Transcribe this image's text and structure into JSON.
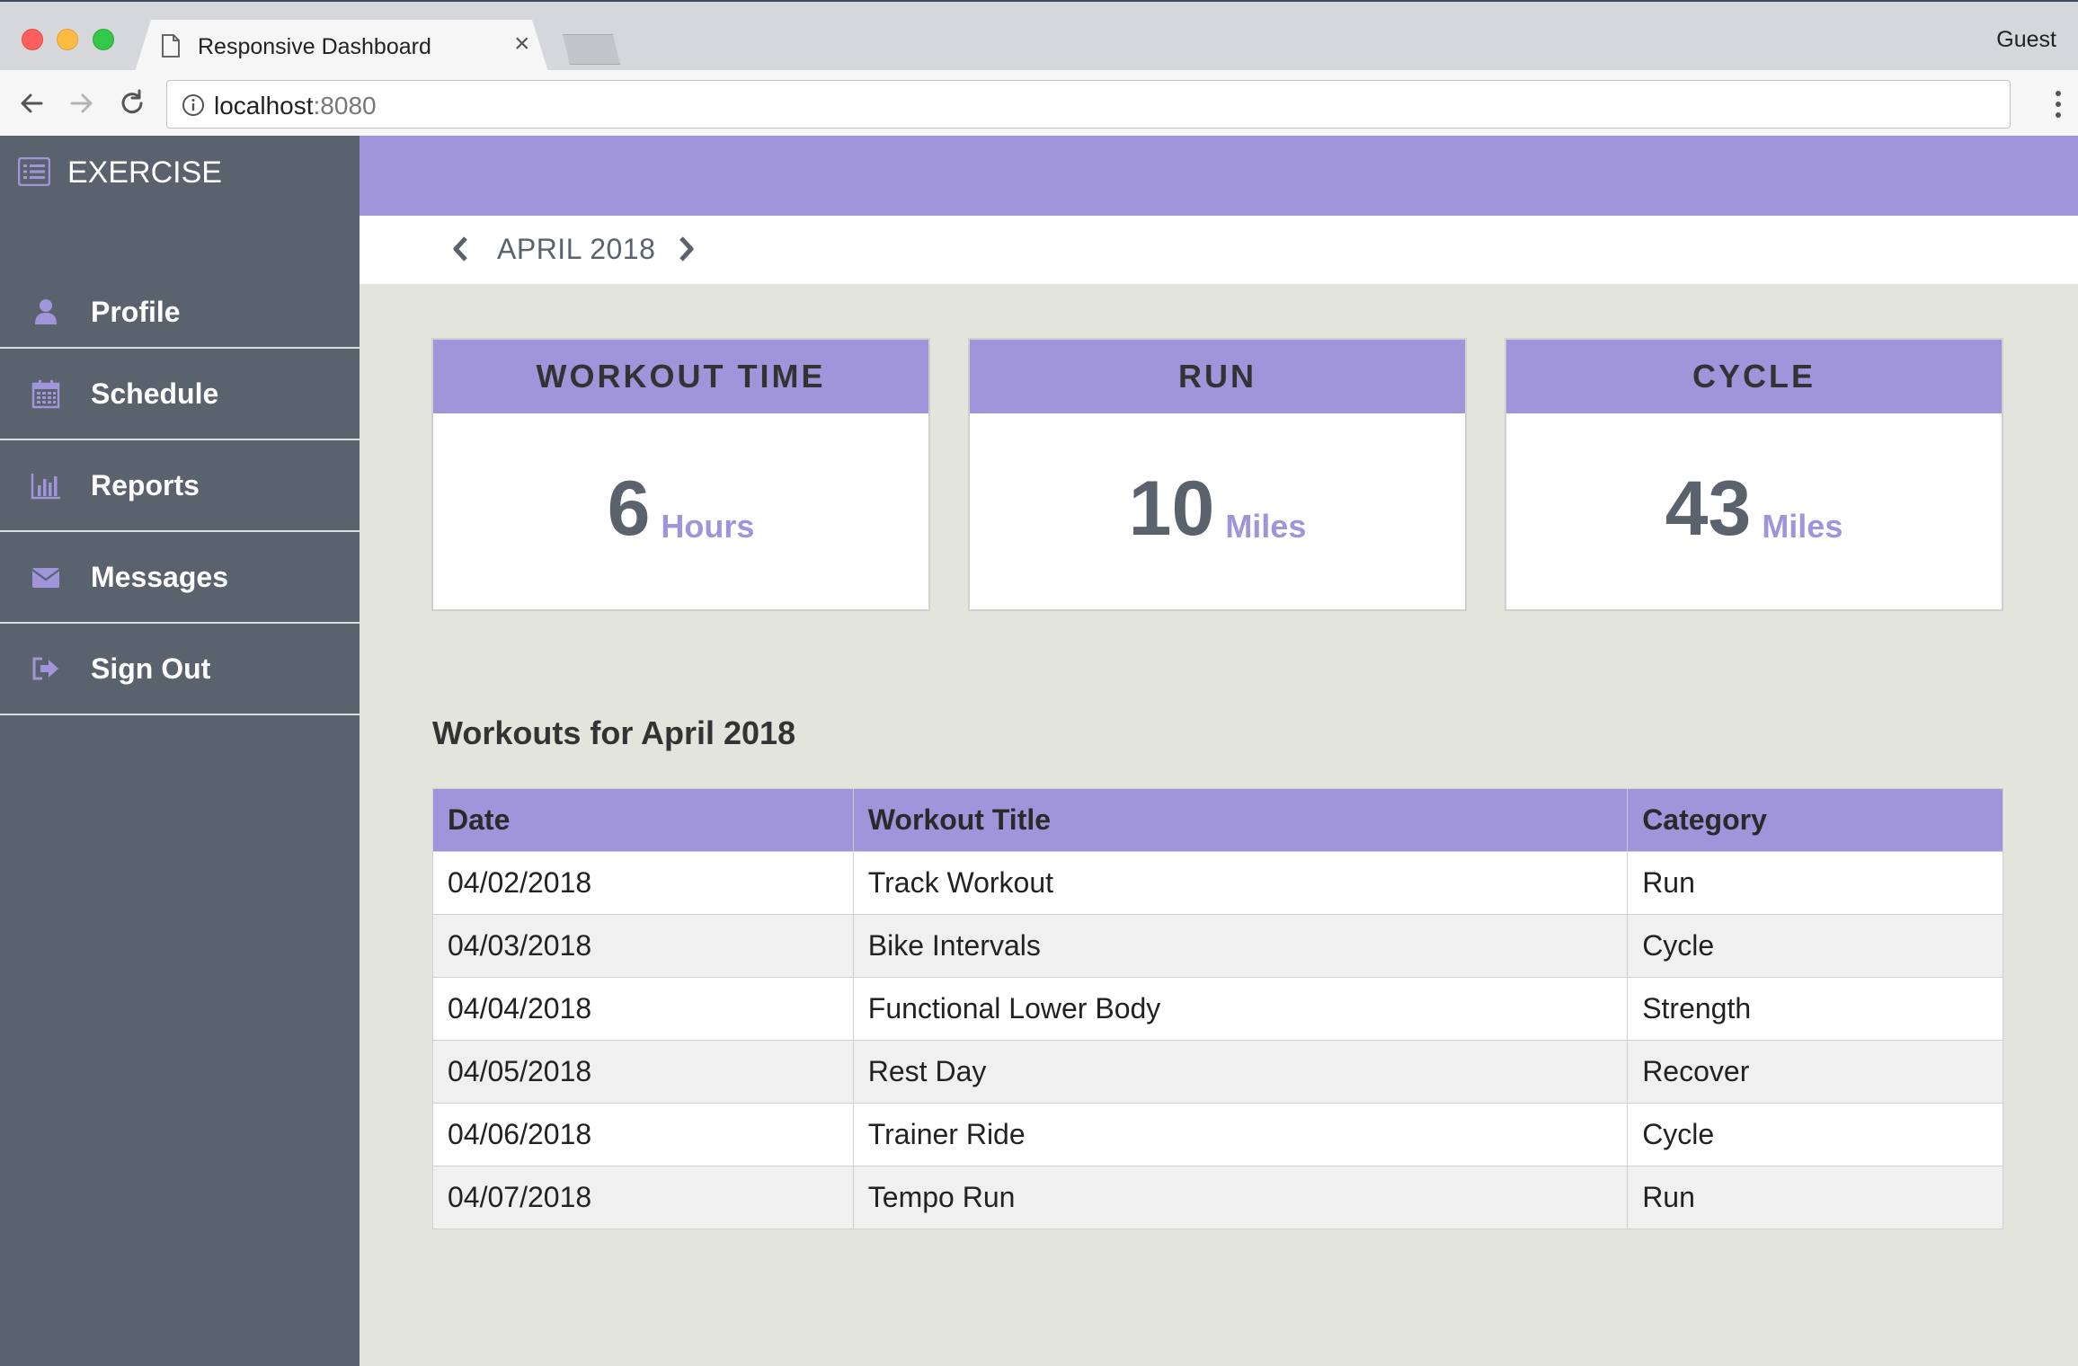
{
  "browser": {
    "tab_title": "Responsive Dashboard",
    "close_glyph": "×",
    "profile": "Guest",
    "url_host": "localhost",
    "url_port": ":8080"
  },
  "sidebar": {
    "brand": "EXERCISE",
    "items": [
      {
        "label": "Profile",
        "icon": "user-icon"
      },
      {
        "label": "Schedule",
        "icon": "calendar-icon"
      },
      {
        "label": "Reports",
        "icon": "bar-chart-icon"
      },
      {
        "label": "Messages",
        "icon": "envelope-icon"
      },
      {
        "label": "Sign Out",
        "icon": "sign-out-icon"
      }
    ]
  },
  "month_nav": {
    "label": "APRIL 2018"
  },
  "stats": [
    {
      "title": "WORKOUT TIME",
      "value": "6",
      "unit": "Hours"
    },
    {
      "title": "RUN",
      "value": "10",
      "unit": "Miles"
    },
    {
      "title": "CYCLE",
      "value": "43",
      "unit": "Miles"
    }
  ],
  "workouts": {
    "title": "Workouts for April 2018",
    "columns": [
      "Date",
      "Workout Title",
      "Category"
    ],
    "rows": [
      [
        "04/02/2018",
        "Track Workout",
        "Run"
      ],
      [
        "04/03/2018",
        "Bike Intervals",
        "Cycle"
      ],
      [
        "04/04/2018",
        "Functional Lower Body",
        "Strength"
      ],
      [
        "04/05/2018",
        "Rest Day",
        "Recover"
      ],
      [
        "04/06/2018",
        "Trainer Ride",
        "Cycle"
      ],
      [
        "04/07/2018",
        "Tempo Run",
        "Run"
      ]
    ]
  },
  "colors": {
    "accent": "#a095db",
    "sidebar": "#59626d",
    "background": "#e3e4dc"
  }
}
